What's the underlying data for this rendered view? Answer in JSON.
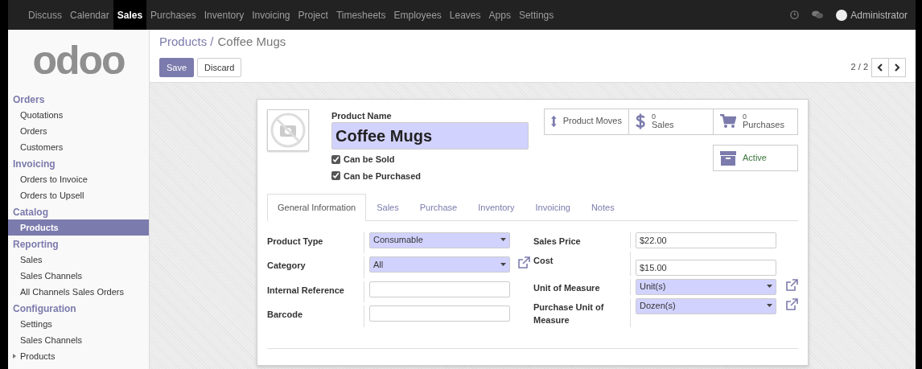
{
  "top_menu": [
    {
      "label": "Discuss",
      "selected": false
    },
    {
      "label": "Calendar",
      "selected": false
    },
    {
      "label": "Sales",
      "selected": true
    },
    {
      "label": "Purchases",
      "selected": false
    },
    {
      "label": "Inventory",
      "selected": false
    },
    {
      "label": "Invoicing",
      "selected": false
    },
    {
      "label": "Project",
      "selected": false
    },
    {
      "label": "Timesheets",
      "selected": false
    },
    {
      "label": "Employees",
      "selected": false
    },
    {
      "label": "Leaves",
      "selected": false
    },
    {
      "label": "Apps",
      "selected": false
    },
    {
      "label": "Settings",
      "selected": false
    }
  ],
  "user": {
    "name": "Administrator"
  },
  "logo": {
    "text": "odoo"
  },
  "sidebar": {
    "sections": [
      {
        "title": "Orders",
        "items": [
          {
            "label": "Quotations",
            "selected": false,
            "expandable": false
          },
          {
            "label": "Orders",
            "selected": false,
            "expandable": false
          },
          {
            "label": "Customers",
            "selected": false,
            "expandable": false
          }
        ]
      },
      {
        "title": "Invoicing",
        "items": [
          {
            "label": "Orders to Invoice",
            "selected": false,
            "expandable": false
          },
          {
            "label": "Orders to Upsell",
            "selected": false,
            "expandable": false
          }
        ]
      },
      {
        "title": "Catalog",
        "items": [
          {
            "label": "Products",
            "selected": true,
            "expandable": false
          }
        ]
      },
      {
        "title": "Reporting",
        "items": [
          {
            "label": "Sales",
            "selected": false,
            "expandable": false
          },
          {
            "label": "Sales Channels",
            "selected": false,
            "expandable": false
          },
          {
            "label": "All Channels Sales Orders",
            "selected": false,
            "expandable": false
          }
        ]
      },
      {
        "title": "Configuration",
        "items": [
          {
            "label": "Settings",
            "selected": false,
            "expandable": false
          },
          {
            "label": "Sales Channels",
            "selected": false,
            "expandable": false
          },
          {
            "label": "Products",
            "selected": false,
            "expandable": true
          }
        ]
      }
    ]
  },
  "breadcrumb": {
    "parent": "Products /",
    "current": "Coffee Mugs"
  },
  "buttons": {
    "save": "Save",
    "discard": "Discard"
  },
  "pager": {
    "text": "2 / 2"
  },
  "form": {
    "name_label": "Product Name",
    "name_value": "Coffee Mugs",
    "checks": [
      {
        "label": "Can be Sold",
        "checked": true
      },
      {
        "label": "Can be Purchased",
        "checked": true
      }
    ],
    "stat_buttons": [
      {
        "kind": "moves",
        "label": "Product Moves"
      },
      {
        "kind": "sales",
        "count": "0",
        "label": "Sales"
      },
      {
        "kind": "purchases",
        "count": "0",
        "label": "Purchases"
      },
      {
        "kind": "active",
        "label": "Active"
      }
    ],
    "tabs": [
      {
        "label": "General Information",
        "selected": true
      },
      {
        "label": "Sales",
        "selected": false
      },
      {
        "label": "Purchase",
        "selected": false
      },
      {
        "label": "Inventory",
        "selected": false
      },
      {
        "label": "Invoicing",
        "selected": false
      },
      {
        "label": "Notes",
        "selected": false
      }
    ],
    "left_fields": [
      {
        "label": "Product Type",
        "kind": "select",
        "value": "Consumable",
        "required": true,
        "link": false
      },
      {
        "label": "Category",
        "kind": "select",
        "value": "All",
        "required": true,
        "link": true
      },
      {
        "label": "Internal Reference",
        "kind": "input",
        "required": false,
        "link": false
      },
      {
        "label": "Barcode",
        "kind": "input",
        "required": false,
        "link": false
      }
    ],
    "right_fields": [
      {
        "label": "Sales Price",
        "kind": "input",
        "value": "$22.00",
        "required": false,
        "link": false
      },
      {
        "label": "Cost",
        "kind": "input",
        "value": "$15.00",
        "required": false,
        "link": false
      },
      {
        "label": "Unit of Measure",
        "kind": "select",
        "value": "Unit(s)",
        "required": true,
        "link": true
      },
      {
        "label": "Purchase Unit of Measure",
        "kind": "select",
        "value": "Dozen(s)",
        "required": true,
        "link": true
      }
    ]
  }
}
